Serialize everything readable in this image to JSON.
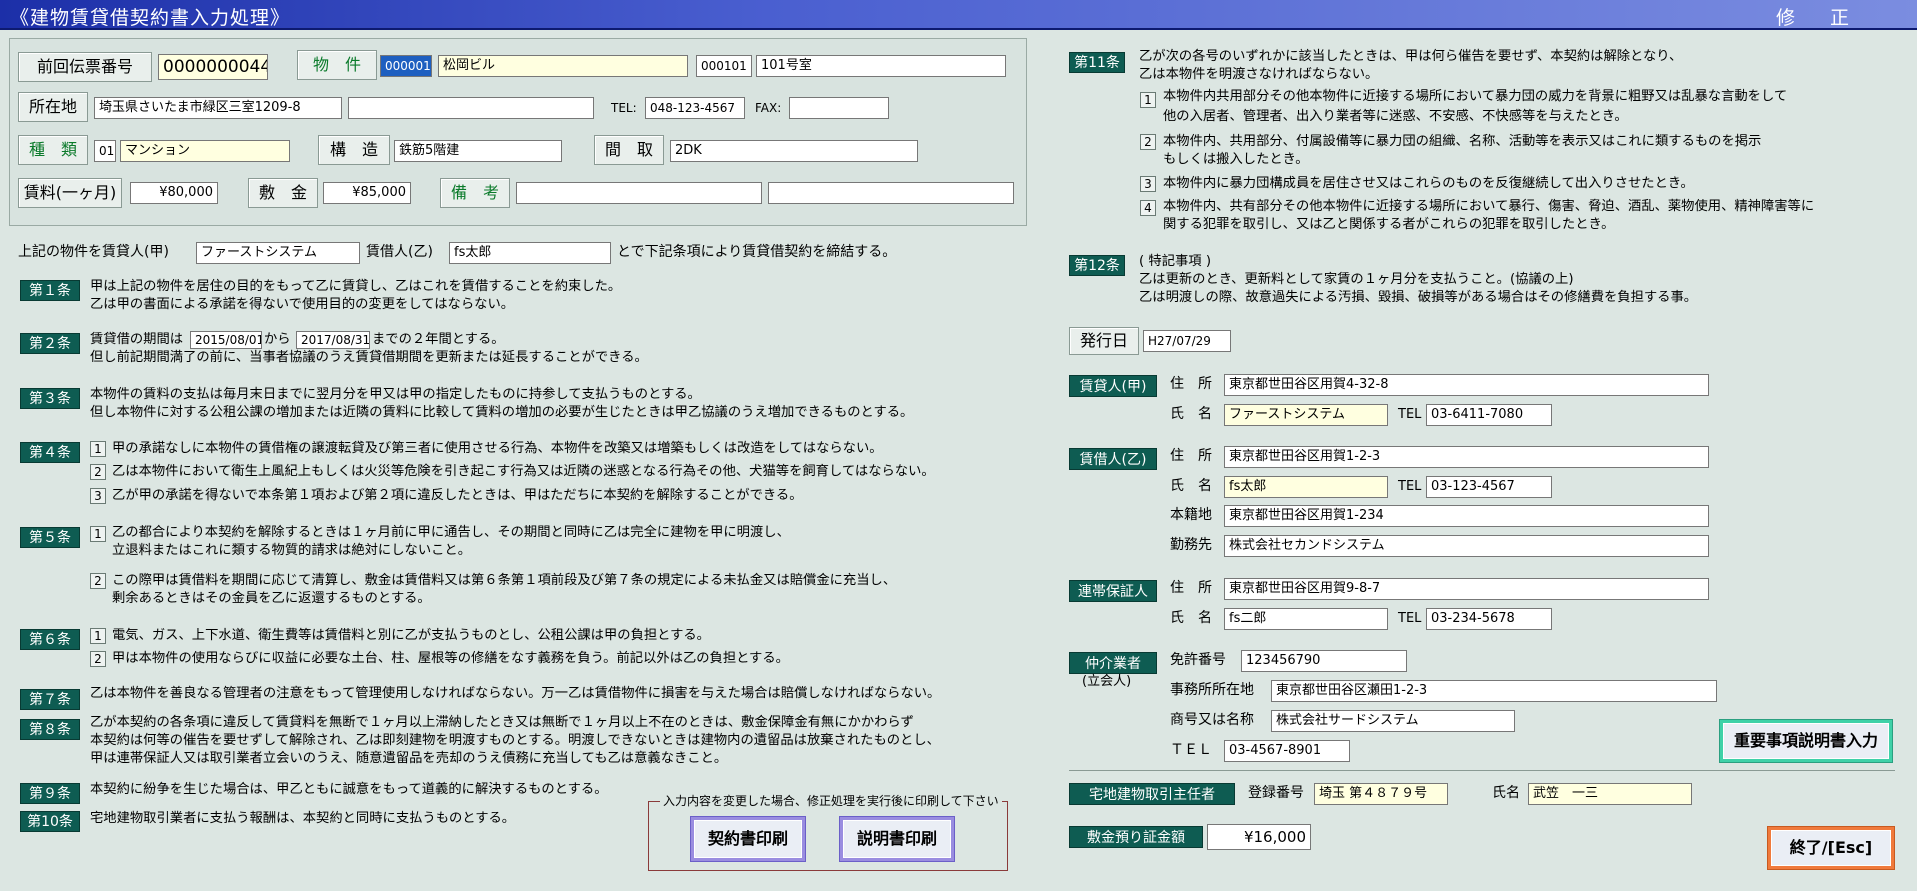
{
  "window": {
    "title": "《建物賃貸借契約書入力処理》",
    "mode": "修　正"
  },
  "header": {
    "prev_slip_label": "前回伝票番号",
    "prev_slip_value": "0000000044",
    "property_label": "物　件",
    "property_code": "000001",
    "property_name": "松岡ビル",
    "room_code": "000101",
    "room_name": "101号室",
    "address_label": "所在地",
    "address_value": "埼玉県さいたま市緑区三室1209-8",
    "address_extra": "",
    "tel_label": "TEL:",
    "tel_value": "048-123-4567",
    "fax_label": "FAX:",
    "fax_value": "",
    "type_label": "種　類",
    "type_code": "01",
    "type_name": "マンション",
    "structure_label": "構　造",
    "structure_value": "鉄筋5階建",
    "layout_label": "間　取",
    "layout_value": "2DK",
    "rent_label": "賃料(一ヶ月)",
    "rent_value": "¥80,000",
    "deposit_label": "敷　金",
    "deposit_value": "¥85,000",
    "remarks_label": "備　考",
    "remarks_1": "",
    "remarks_2": ""
  },
  "intro": {
    "pre": "上記の物件を賃貸人(甲)",
    "lessor": "ファーストシステム",
    "mid": "賃借人(乙)",
    "lessee": "fs太郎",
    "post": "とで下記条項により賃貸借契約を締結する。"
  },
  "articles": {
    "a1": {
      "label": "第１条",
      "l1": "甲は上記の物件を居住の目的をもって乙に賃貸し、乙はこれを賃借することを約束した。",
      "l2": "乙は甲の書面による承諾を得ないで使用目的の変更をしてはならない。"
    },
    "a2": {
      "label": "第２条",
      "p1": "賃貸借の期間は",
      "start": "2015/08/01",
      "p2": "から",
      "end": "2017/08/31",
      "p3": "までの２年間とする。",
      "l2": "但し前記期間満了の前に、当事者協議のうえ賃貸借期間を更新または延長することができる。"
    },
    "a3": {
      "label": "第３条",
      "l1": "本物件の賃料の支払は毎月末日までに翌月分を甲又は甲の指定したものに持参して支払うものとする。",
      "l2": "但し本物件に対する公租公課の増加または近隣の賃料に比較して賃料の増加の必要が生じたときは甲乙協議のうえ増加できるものとする。"
    },
    "a4": {
      "label": "第４条",
      "i1": "甲の承諾なしに本物件の賃借権の譲渡転貸及び第三者に使用させる行為、本物件を改築又は増築もしくは改造をしてはならない。",
      "i2": "乙は本物件において衛生上風紀上もしくは火災等危険を引き起こす行為又は近隣の迷惑となる行為その他、犬猫等を飼育してはならない。",
      "i3": "乙が甲の承諾を得ないで本条第１項および第２項に違反したときは、甲はただちに本契約を解除することができる。"
    },
    "a5": {
      "label": "第５条",
      "i1a": "乙の都合により本契約を解除するときは１ヶ月前に甲に通告し、その期間と同時に乙は完全に建物を甲に明渡し、",
      "i1b": "立退料またはこれに類する物質的請求は絶対にしないこと。",
      "i2a": "この際甲は賃借料を期間に応じて清算し、敷金は賃借料又は第６条第１項前段及び第７条の規定による未払金又は賠償金に充当し、",
      "i2b": "剰余あるときはその金員を乙に返還するものとする。"
    },
    "a6": {
      "label": "第６条",
      "i1": "電気、ガス、上下水道、衛生費等は賃借料と別に乙が支払うものとし、公租公課は甲の負担とする。",
      "i2": "甲は本物件の使用ならびに収益に必要な土台、柱、屋根等の修繕をなす義務を負う。前記以外は乙の負担とする。"
    },
    "a7": {
      "label": "第７条",
      "l1": "乙は本物件を善良なる管理者の注意をもって管理使用しなければならない。万一乙は賃借物件に損害を与えた場合は賠償しなければならない。"
    },
    "a8": {
      "label": "第８条",
      "l1": "乙が本契約の各条項に違反して賃貸料を無断で１ヶ月以上滞納したとき又は無断で１ヶ月以上不在のときは、敷金保障金有無にかかわらず",
      "l2": "本契約は何等の催告を要せずして解除され、乙は即刻建物を明渡すものとする。明渡しできないときは建物内の遺留品は放棄されたものとし、",
      "l3": "甲は連帯保証人又は取引業者立会いのうえ、随意遺留品を売却のうえ債務に充当しても乙は意義なきこと。"
    },
    "a9": {
      "label": "第９条",
      "l1": "本契約に紛争を生じた場合は、甲乙ともに誠意をもって道義的に解決するものとする。"
    },
    "a10": {
      "label": "第10条",
      "l1": "宅地建物取引業者に支払う報酬は、本契約と同時に支払うものとする。"
    },
    "a11": {
      "label": "第11条",
      "l1": "乙が次の各号のいずれかに該当したときは、甲は何ら催告を要せず、本契約は解除となり、",
      "l2": "乙は本物件を明渡さなければならない。",
      "i1a": "本物件内共用部分その他本物件に近接する場所において暴力団の威力を背景に粗野又は乱暴な言動をして",
      "i1b": "他の入居者、管理者、出入り業者等に迷惑、不安感、不快感等を与えたとき。",
      "i2a": "本物件内、共用部分、付属設備等に暴力団の組織、名称、活動等を表示又はこれに類するものを掲示",
      "i2b": "もしくは搬入したとき。",
      "i3": "本物件内に暴力団構成員を居住させ又はこれらのものを反復継続して出入りさせたとき。",
      "i4a": "本物件内、共有部分その他本物件に近接する場所において暴行、傷害、脅迫、酒乱、薬物使用、精神障害等に",
      "i4b": "関する犯罪を取引し、又は乙と関係する者がこれらの犯罪を取引したとき。"
    },
    "a12": {
      "label": "第12条",
      "h": "( 特記事項 )",
      "l1": "乙は更新のとき、更新料として家賃の１ヶ月分を支払うこと。(協議の上)",
      "l2": "乙は明渡しの際、故意過失による汚損、毀損、破損等がある場合はその修繕費を負担する事。"
    }
  },
  "numbers": [
    "1",
    "2",
    "3",
    "4"
  ],
  "issue": {
    "label": "発行日",
    "value": "H27/07/29"
  },
  "lessor": {
    "label": "賃貸人(甲)",
    "addr_label": "住　所",
    "addr": "東京都世田谷区用賀4-32-8",
    "name_label": "氏　名",
    "name": "ファーストシステム",
    "tel_label": "TEL",
    "tel": "03-6411-7080"
  },
  "lessee": {
    "label": "賃借人(乙)",
    "addr_label": "住　所",
    "addr": "東京都世田谷区用賀1-2-3",
    "name_label": "氏　名",
    "name": "fs太郎",
    "tel_label": "TEL",
    "tel": "03-123-4567",
    "domicile_label": "本籍地",
    "domicile": "東京都世田谷区用賀1-234",
    "work_label": "勤務先",
    "work": "株式会社セカンドシステム"
  },
  "guarantor": {
    "label": "連帯保証人",
    "addr_label": "住　所",
    "addr": "東京都世田谷区用賀9-8-7",
    "name_label": "氏　名",
    "name": "fs二郎",
    "tel_label": "TEL",
    "tel": "03-234-5678"
  },
  "agent": {
    "label": "仲介業者",
    "sub": "(立会人)",
    "license_label": "免許番号",
    "license": "123456790",
    "office_label": "事務所所在地",
    "office": "東京都世田谷区瀬田1-2-3",
    "company_label": "商号又は名称",
    "company": "株式会社サードシステム",
    "tel_label": "ＴＥＬ",
    "tel": "03-4567-8901"
  },
  "broker": {
    "label": "宅地建物取引主任者",
    "reg_label": "登録番号",
    "reg": "埼玉 第４８７９号",
    "name_label": "氏名",
    "name": "武笠　一三"
  },
  "deposit_cert": {
    "label": "敷金預り証金額",
    "value": "¥16,000"
  },
  "print_box": {
    "note": "入力内容を変更した場合、修正処理を実行後に印刷して下さい",
    "contract_btn": "契約書印刷",
    "explain_btn": "説明書印刷"
  },
  "buttons": {
    "important": "重要事項説明書入力",
    "exit": "終了/[Esc]"
  }
}
